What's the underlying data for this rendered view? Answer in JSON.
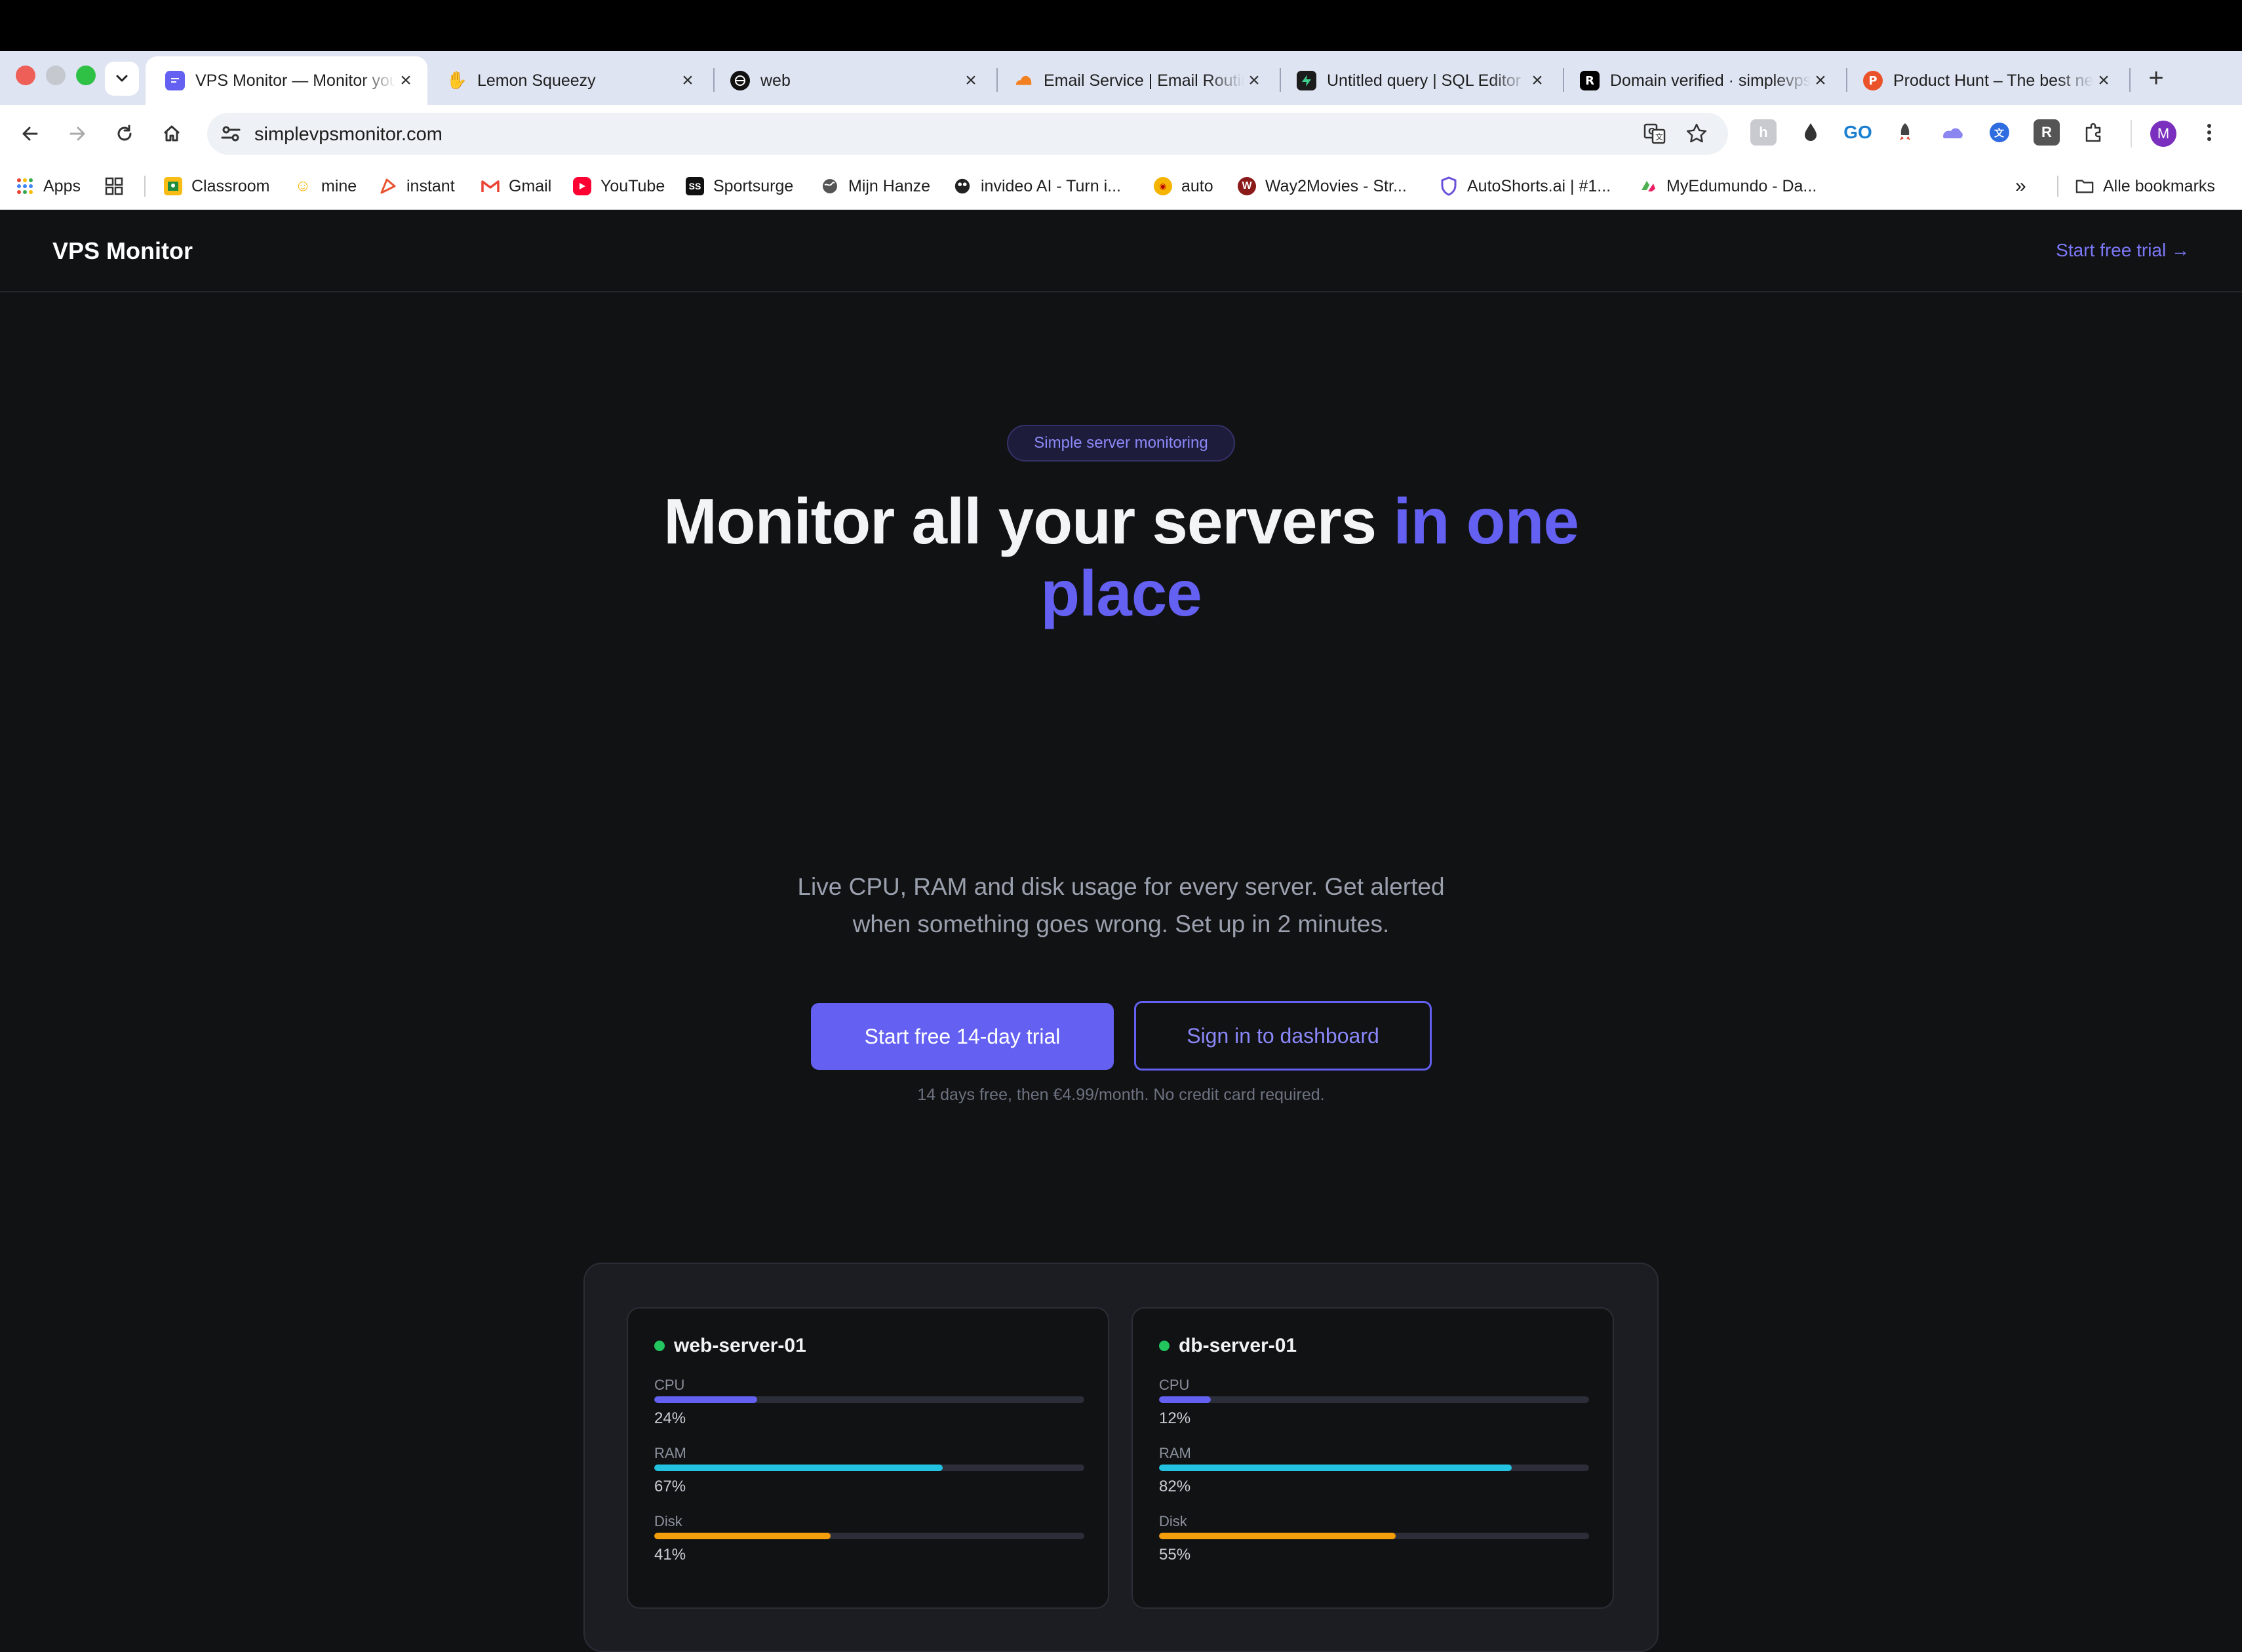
{
  "browser": {
    "tabs": [
      {
        "title": "VPS Monitor — Monitor your servers in one place",
        "favicon": "vps-monitor-favicon",
        "active": true
      },
      {
        "title": "Lemon Squeezy",
        "favicon": "lemon-squeezy-favicon",
        "active": false
      },
      {
        "title": "web",
        "favicon": "web-favicon",
        "active": false
      },
      {
        "title": "Email Service | Email Routing",
        "favicon": "cloudflare-favicon",
        "active": false
      },
      {
        "title": "Untitled query | SQL Editor",
        "favicon": "supabase-favicon",
        "active": false
      },
      {
        "title": "Domain verified · simplevpsmonitor",
        "favicon": "resend-favicon",
        "active": false
      },
      {
        "title": "Product Hunt – The best new products",
        "favicon": "product-hunt-favicon",
        "active": false
      }
    ],
    "url": "simplevpsmonitor.com",
    "profile_initial": "M",
    "bookmarks": [
      {
        "label": "Apps"
      },
      {
        "label": ""
      },
      {
        "label": "Classroom"
      },
      {
        "label": "mine"
      },
      {
        "label": "instant"
      },
      {
        "label": "Gmail"
      },
      {
        "label": "YouTube"
      },
      {
        "label": "Sportsurge"
      },
      {
        "label": "Mijn Hanze"
      },
      {
        "label": "invideo AI - Turn i..."
      },
      {
        "label": "auto"
      },
      {
        "label": "Way2Movies - Str..."
      },
      {
        "label": "AutoShorts.ai | #1..."
      },
      {
        "label": "MyEdumundo - Da..."
      }
    ],
    "all_bookmarks": "Alle bookmarks"
  },
  "site": {
    "brand": "VPS Monitor",
    "header_cta": "Start free trial →",
    "badge": "Simple server monitoring",
    "headline_main": "Monitor all your servers ",
    "headline_accent": "in one place",
    "subhead": "Live CPU, RAM and disk usage for every server. Get alerted when something goes wrong. Set up in 2 minutes.",
    "primary_button": "Start free 14-day trial",
    "secondary_button": "Sign in to dashboard",
    "fineprint": "14 days free, then €4.99/month. No credit card required."
  },
  "servers": [
    {
      "name": "web-server-01",
      "status_color": "#22c55e",
      "metrics": [
        {
          "label": "CPU",
          "percent": 24,
          "value": "24%"
        },
        {
          "label": "RAM",
          "percent": 67,
          "value": "67%"
        },
        {
          "label": "Disk",
          "percent": 41,
          "value": "41%"
        }
      ]
    },
    {
      "name": "db-server-01",
      "status_color": "#22c55e",
      "metrics": [
        {
          "label": "CPU",
          "percent": 12,
          "value": "12%"
        },
        {
          "label": "RAM",
          "percent": 82,
          "value": "82%"
        },
        {
          "label": "Disk",
          "percent": 55,
          "value": "55%"
        }
      ]
    }
  ],
  "colors": {
    "accent": "#6360f2",
    "cpu": "#6360f2",
    "ram": "#22c2e0",
    "disk": "#f59e0b",
    "online": "#22c55e"
  }
}
